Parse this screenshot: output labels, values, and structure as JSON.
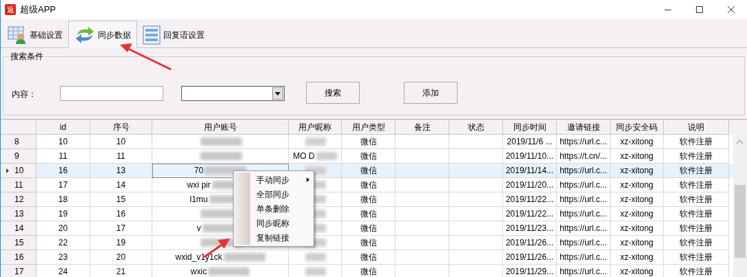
{
  "window": {
    "title": "超级APP",
    "app_icon_text": "返"
  },
  "tabs": [
    {
      "label": "基础设置",
      "selected": false
    },
    {
      "label": "同步数据",
      "selected": true
    },
    {
      "label": "回复语设置",
      "selected": false
    }
  ],
  "search_group": {
    "title": "搜索条件",
    "content_label": "内容：",
    "buttons": [
      "搜索",
      "添加"
    ]
  },
  "table": {
    "columns": [
      "id",
      "序号",
      "用户账号",
      "用户昵称",
      "用户类型",
      "备注",
      "状态",
      "同步时间",
      "邀请链接",
      "同步安全码",
      "说明"
    ],
    "rows": [
      {
        "row_header": "8",
        "selected": false,
        "cells": [
          "10",
          "10",
          "",
          "",
          "微信",
          "",
          "",
          "2019/11/6 ...",
          "https://url.c...",
          "xz-xitong",
          "软件注册"
        ]
      },
      {
        "row_header": "9",
        "selected": false,
        "cells": [
          "11",
          "11",
          "",
          "MO D",
          "微信",
          "",
          "",
          "2019/11/10...",
          "https://t.cn/...",
          "xz-xitong",
          "软件注册"
        ]
      },
      {
        "row_header": "10",
        "selected": true,
        "cells": [
          "16",
          "13",
          "70",
          "",
          "微信",
          "",
          "",
          "2019/11/14...",
          "https://url.c...",
          "xz-xitong",
          "软件注册"
        ]
      },
      {
        "row_header": "11",
        "selected": false,
        "cells": [
          "17",
          "14",
          "wxi pir",
          "",
          "微信",
          "",
          "",
          "2019/11/20...",
          "https://url.c...",
          "xz-xitong",
          "软件注册"
        ]
      },
      {
        "row_header": "12",
        "selected": false,
        "cells": [
          "18",
          "15",
          "l1mu",
          "",
          "微信",
          "",
          "",
          "2019/11/22...",
          "https://url.c...",
          "xz-xitong",
          "软件注册"
        ]
      },
      {
        "row_header": "13",
        "selected": false,
        "cells": [
          "19",
          "16",
          "",
          "",
          "微信",
          "",
          "",
          "2019/11/22...",
          "https://url.c...",
          "xz-xitong",
          "软件注册"
        ]
      },
      {
        "row_header": "14",
        "selected": false,
        "cells": [
          "20",
          "17",
          "v",
          "",
          "微信",
          "",
          "",
          "2019/11/23...",
          "https://url.c...",
          "xz-xitong",
          "软件注册"
        ]
      },
      {
        "row_header": "15",
        "selected": false,
        "cells": [
          "22",
          "19",
          "",
          "",
          "微信",
          "",
          "",
          "2019/11/26...",
          "https://url.c...",
          "xz-xitong",
          "软件注册"
        ]
      },
      {
        "row_header": "16",
        "selected": false,
        "cells": [
          "23",
          "20",
          "wxid_v1y1ck",
          "",
          "微信",
          "",
          "",
          "2019/11/26...",
          "https://url.c...",
          "xz-xitong",
          "软件注册"
        ]
      },
      {
        "row_header": "17",
        "selected": false,
        "cells": [
          "24",
          "21",
          "wxic",
          "",
          "微信",
          "",
          "",
          "2019/11/29...",
          "https://url.c...",
          "xz-xitong",
          "软件注册"
        ]
      }
    ]
  },
  "context_menu": {
    "items": [
      {
        "label": "手动同步",
        "has_submenu": true
      },
      {
        "label": "全部同步",
        "has_submenu": false
      },
      {
        "label": "单条删除",
        "has_submenu": false
      },
      {
        "label": "同步昵称",
        "has_submenu": false
      },
      {
        "label": "复制链接",
        "has_submenu": false
      }
    ]
  }
}
